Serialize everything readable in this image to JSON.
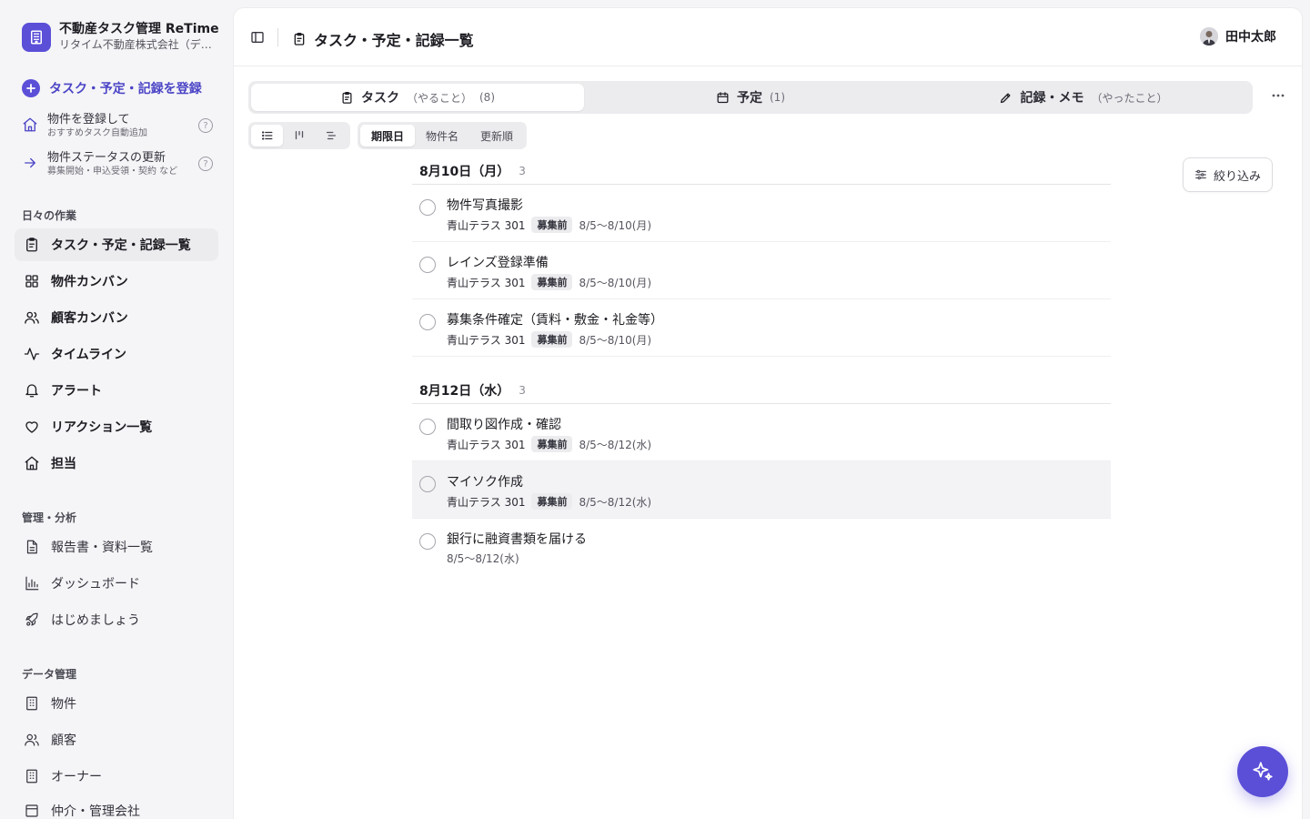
{
  "brand": {
    "title": "不動産タスク管理 ReTime",
    "subtitle": "リタイム不動産株式会社（デモ）"
  },
  "sidebar": {
    "primary_action": "タスク・予定・記録を登録",
    "sub_actions": [
      {
        "title": "物件を登録して",
        "note": "おすすめタスク自動追加"
      },
      {
        "title": "物件ステータスの更新",
        "note": "募集開始・申込受領・契約 など"
      }
    ],
    "help_glyph": "?",
    "sections": {
      "daily": "日々の作業",
      "manage": "管理・分析",
      "data": "データ管理"
    },
    "daily_items": [
      {
        "label": "タスク・予定・記録一覧",
        "icon": "clipboard-icon"
      },
      {
        "label": "物件カンバン",
        "icon": "grid-icon"
      },
      {
        "label": "顧客カンバン",
        "icon": "users-icon"
      },
      {
        "label": "タイムライン",
        "icon": "activity-icon"
      },
      {
        "label": "アラート",
        "icon": "bell-icon"
      },
      {
        "label": "リアクション一覧",
        "icon": "heart-icon"
      },
      {
        "label": "担当",
        "icon": "home-icon"
      }
    ],
    "manage_items": [
      {
        "label": "報告書・資料一覧",
        "icon": "document-icon"
      },
      {
        "label": "ダッシュボード",
        "icon": "bar-chart-icon"
      },
      {
        "label": "はじめましょう",
        "icon": "rocket-icon"
      }
    ],
    "data_items": [
      {
        "label": "物件",
        "icon": "building-icon"
      },
      {
        "label": "顧客",
        "icon": "users-icon"
      },
      {
        "label": "オーナー",
        "icon": "building-icon"
      },
      {
        "label": "仲介・管理会社",
        "icon": "store-icon"
      }
    ]
  },
  "header": {
    "title": "タスク・予定・記録一覧",
    "user": "田中太郎"
  },
  "tabs": [
    {
      "label": "タスク",
      "sub": "（やること）",
      "count": "(8)"
    },
    {
      "label": "予定",
      "sub": "",
      "count": "(1)"
    },
    {
      "label": "記録・メモ",
      "sub": "（やったこと）",
      "count": ""
    }
  ],
  "sort": {
    "options": [
      "期限日",
      "物件名",
      "更新順"
    ],
    "active": "期限日"
  },
  "filter_label": "絞り込み",
  "groups": [
    {
      "date": "8月10日（月）",
      "count": "3",
      "tasks": [
        {
          "title": "物件写真撮影",
          "property": "青山テラス 301",
          "badge": "募集前",
          "range": "8/5〜8/10(月)"
        },
        {
          "title": "レインズ登録準備",
          "property": "青山テラス 301",
          "badge": "募集前",
          "range": "8/5〜8/10(月)"
        },
        {
          "title": "募集条件確定（賃料・敷金・礼金等）",
          "property": "青山テラス 301",
          "badge": "募集前",
          "range": "8/5〜8/10(月)"
        }
      ]
    },
    {
      "date": "8月12日（水）",
      "count": "3",
      "tasks": [
        {
          "title": "間取り図作成・確認",
          "property": "青山テラス 301",
          "badge": "募集前",
          "range": "8/5〜8/12(水)"
        },
        {
          "title": "マイソク作成",
          "property": "青山テラス 301",
          "badge": "募集前",
          "range": "8/5〜8/12(水)"
        },
        {
          "title": "銀行に融資書類を届ける",
          "property": "",
          "badge": "",
          "range": "8/5〜8/12(水)"
        }
      ]
    }
  ],
  "colors": {
    "accent": "#5b4fd8",
    "accent_text": "#4b44c6",
    "active_bg": "#ececef"
  }
}
